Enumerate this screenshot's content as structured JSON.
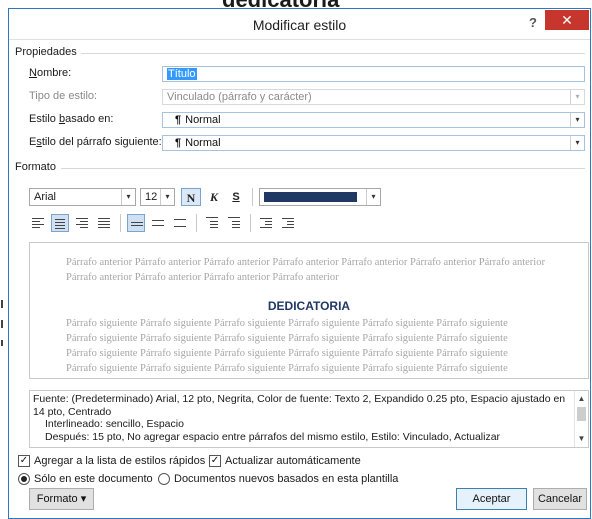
{
  "window": {
    "title": "Modificar estilo",
    "help": "?",
    "close": "✕"
  },
  "properties": {
    "section_label": "Propiedades",
    "name_label": "Nombre:",
    "name_value": "Título",
    "style_type_label": "Tipo de estilo:",
    "style_type_value": "Vinculado (párrafo y carácter)",
    "based_on_label": "Estilo basado en:",
    "based_on_value": "Normal",
    "next_label": "Estilo del párrafo siguiente:",
    "next_value": "Normal"
  },
  "format": {
    "section_label": "Formato",
    "font": "Arial",
    "size": "12",
    "bold_label": "N",
    "italic_label": "K",
    "underline_label": "S",
    "font_color": "#1f3864"
  },
  "preview": {
    "previous_para": "Párrafo anterior Párrafo anterior Párrafo anterior Párrafo anterior Párrafo anterior Párrafo anterior Párrafo anterior Párrafo anterior Párrafo anterior Párrafo anterior Párrafo anterior",
    "heading": "DEDICATORIA",
    "following_line": "Párrafo siguiente Párrafo siguiente Párrafo siguiente Párrafo siguiente Párrafo siguiente Párrafo siguiente"
  },
  "description": {
    "line1": "Fuente: (Predeterminado) Arial, 12 pto, Negrita, Color de fuente: Texto 2, Expandido  0.25 pto, Espacio ajustado en",
    "line2": "14 pto, Centrado",
    "line3": "Interlineado:  sencillo, Espacio",
    "line4": "Después:  15 pto, No agregar espacio entre párrafos del mismo estilo, Estilo: Vinculado, Actualizar"
  },
  "options": {
    "add_quick_styles": "Agregar a la lista de estilos rápidos",
    "auto_update": "Actualizar automáticamente",
    "only_this_doc": "Sólo en este documento",
    "new_docs_template": "Documentos nuevos basados en esta plantilla"
  },
  "buttons": {
    "format_menu": "Formato",
    "accept": "Aceptar",
    "cancel": "Cancelar"
  }
}
